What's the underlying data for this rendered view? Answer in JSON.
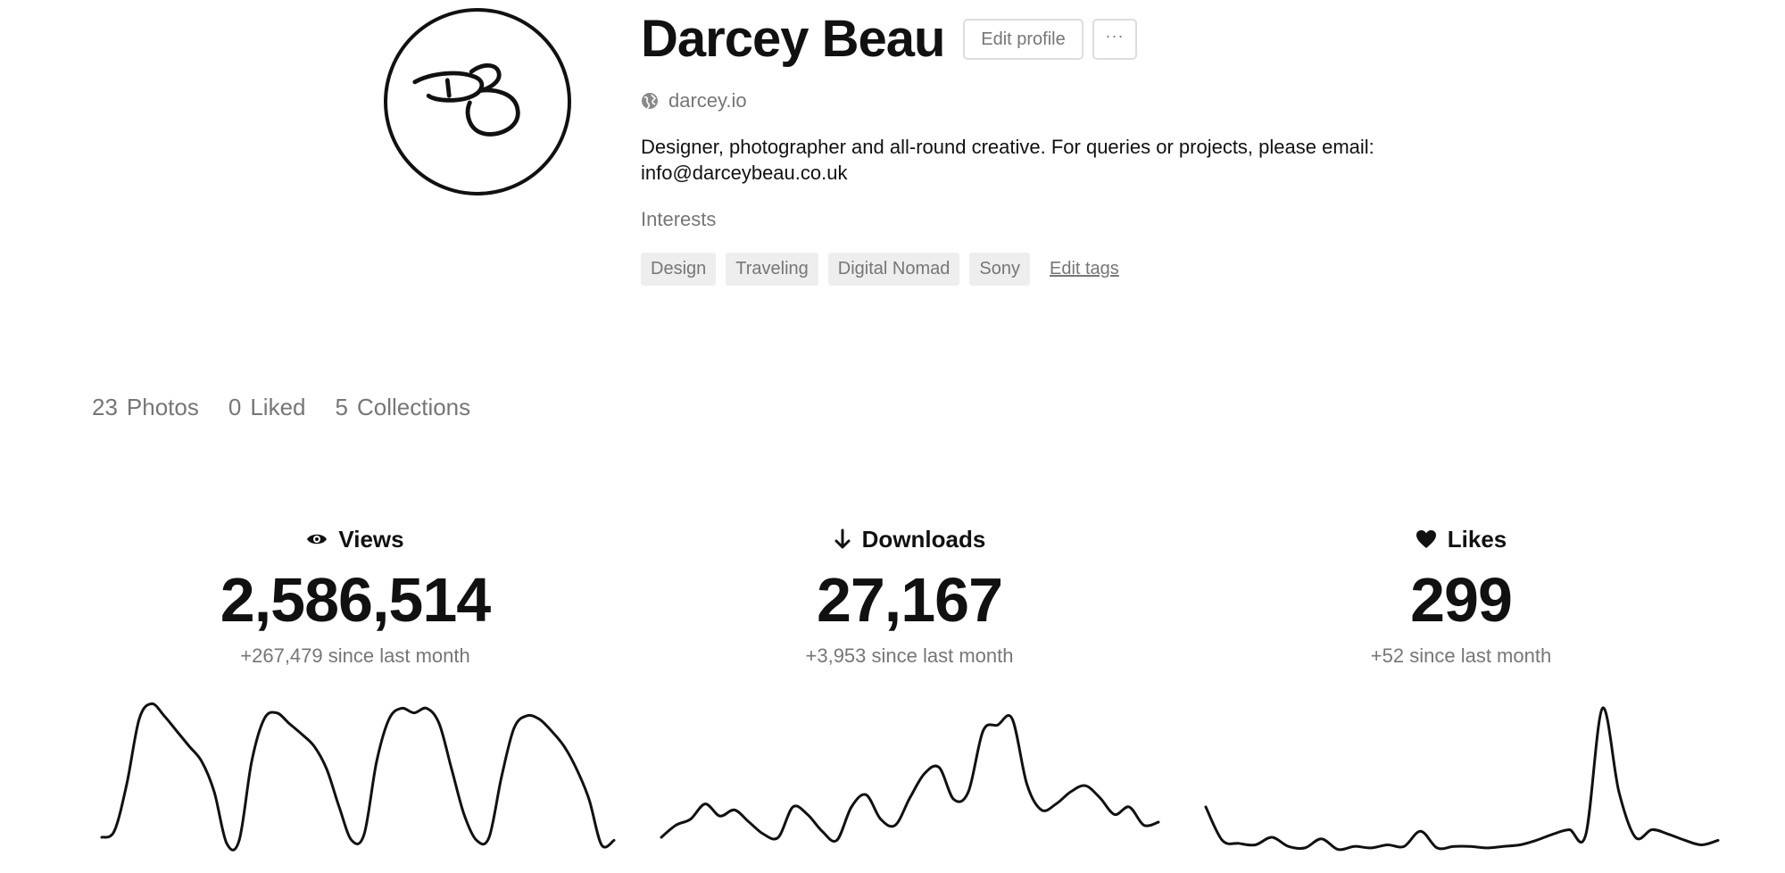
{
  "profile": {
    "name": "Darcey Beau",
    "website": "darcey.io",
    "bio": "Designer, photographer and all-round creative. For queries or projects, please email: info@darceybeau.co.uk",
    "interests_label": "Interests",
    "tags": [
      "Design",
      "Traveling",
      "Digital Nomad",
      "Sony"
    ],
    "edit_tags_label": "Edit tags",
    "avatar_monogram": "DB",
    "avatar_icon": "monogram-logo"
  },
  "header": {
    "edit_profile_label": "Edit profile",
    "more_label": "···"
  },
  "counts": [
    {
      "value": "23",
      "label": "Photos"
    },
    {
      "value": "0",
      "label": "Liked"
    },
    {
      "value": "5",
      "label": "Collections"
    }
  ],
  "stats": {
    "views": {
      "label": "Views",
      "value": "2,586,514",
      "delta": "+267,479 since last month",
      "icon": "eye-icon"
    },
    "downloads": {
      "label": "Downloads",
      "value": "27,167",
      "delta": "+3,953 since last month",
      "icon": "arrow-down-icon"
    },
    "likes": {
      "label": "Likes",
      "value": "299",
      "delta": "+52 since last month",
      "icon": "heart-icon"
    }
  },
  "colors": {
    "text": "#111111",
    "muted": "#767676",
    "tag_bg": "#eeeeee",
    "border": "#dddddd"
  },
  "chart_data": [
    {
      "type": "line",
      "title": "Views",
      "values": [
        10,
        14,
        45,
        88,
        98,
        90,
        80,
        70,
        60,
        40,
        6,
        8,
        60,
        88,
        92,
        85,
        78,
        70,
        55,
        30,
        8,
        12,
        60,
        88,
        95,
        92,
        95,
        85,
        55,
        25,
        8,
        10,
        50,
        82,
        90,
        88,
        80,
        70,
        55,
        35,
        5,
        8
      ],
      "ylim": [
        0,
        100
      ]
    },
    {
      "type": "line",
      "title": "Downloads",
      "values": [
        10,
        18,
        22,
        32,
        24,
        28,
        20,
        12,
        10,
        30,
        25,
        14,
        8,
        30,
        38,
        22,
        18,
        36,
        52,
        56,
        35,
        40,
        80,
        84,
        88,
        45,
        28,
        32,
        40,
        44,
        36,
        25,
        30,
        18,
        20
      ],
      "ylim": [
        0,
        100
      ]
    },
    {
      "type": "line",
      "title": "Likes",
      "values": [
        30,
        8,
        6,
        5,
        10,
        4,
        3,
        9,
        2,
        4,
        3,
        5,
        4,
        14,
        3,
        4,
        4,
        3,
        4,
        5,
        8,
        12,
        15,
        12,
        95,
        40,
        10,
        15,
        12,
        8,
        5,
        8
      ],
      "ylim": [
        0,
        100
      ]
    }
  ]
}
